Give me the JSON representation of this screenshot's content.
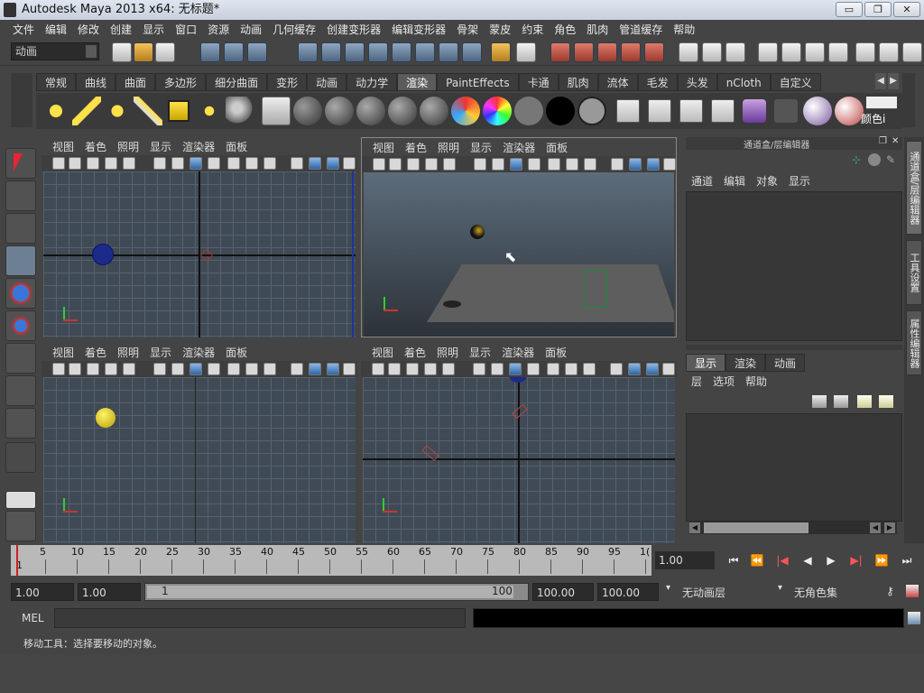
{
  "window": {
    "title": "Autodesk Maya 2013 x64: 无标题*",
    "minimize": "▭",
    "restore": "❐",
    "close": "✕"
  },
  "menubar": [
    "文件",
    "编辑",
    "修改",
    "创建",
    "显示",
    "窗口",
    "资源",
    "动画",
    "几何缓存",
    "创建变形器",
    "编辑变形器",
    "骨架",
    "蒙皮",
    "约束",
    "角色",
    "肌肉",
    "管道缓存",
    "帮助"
  ],
  "statusline": {
    "mode_value": "动画"
  },
  "shelf": {
    "tabs": [
      "常规",
      "曲线",
      "曲面",
      "多边形",
      "细分曲面",
      "变形",
      "动画",
      "动力学",
      "渲染",
      "PaintEffects",
      "卡通",
      "肌肉",
      "流体",
      "毛发",
      "头发",
      "nCloth",
      "自定义"
    ],
    "active_tab": "渲染",
    "last_icon_label": "颜色i"
  },
  "viewport_menu": [
    "视图",
    "着色",
    "照明",
    "显示",
    "渲染器",
    "面板"
  ],
  "channel_box": {
    "title": "通道盒/层编辑器",
    "menu": [
      "通道",
      "编辑",
      "对象",
      "显示"
    ],
    "layer_tabs": [
      "显示",
      "渲染",
      "动画"
    ],
    "layer_menu": [
      "层",
      "选项",
      "帮助"
    ]
  },
  "side_tabs": [
    "通道盒/层编辑器",
    "工具设置",
    "属性编辑器"
  ],
  "timeslider": {
    "start_label": "1",
    "ticks": [
      "5",
      "10",
      "15",
      "20",
      "25",
      "30",
      "35",
      "40",
      "45",
      "50",
      "55",
      "60",
      "65",
      "70",
      "75",
      "80",
      "85",
      "90",
      "95",
      "1("
    ],
    "current_frame": "1.00"
  },
  "range": {
    "start": "1.00",
    "play_start": "1.00",
    "bar_start": "1",
    "bar_end": "100",
    "play_end": "100.00",
    "end": "100.00",
    "anim_layer": "无动画层",
    "char_set": "无角色集"
  },
  "mel": {
    "label": "MEL"
  },
  "helpline": "移动工具：选择要移动的对象。"
}
